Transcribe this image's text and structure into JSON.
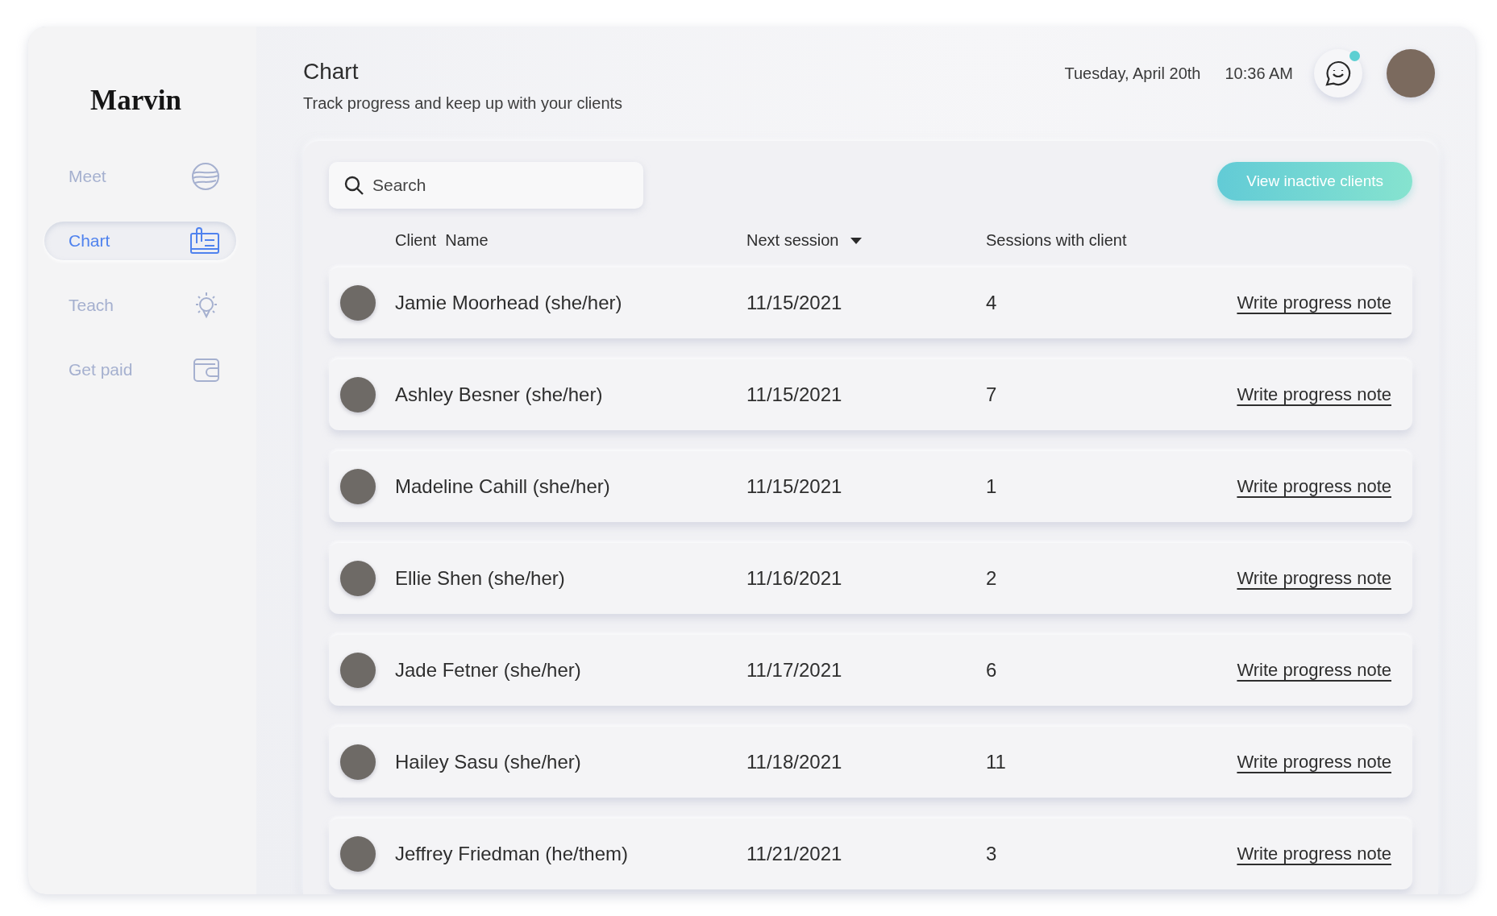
{
  "sidebar": {
    "logo": "Marvin",
    "items": [
      {
        "label": "Meet",
        "kind": "globe",
        "selected": false
      },
      {
        "label": "Chart",
        "kind": "clipboard",
        "selected": true
      },
      {
        "label": "Teach",
        "kind": "bulb",
        "selected": false
      },
      {
        "label": "Get paid",
        "kind": "wallet",
        "selected": false
      }
    ]
  },
  "header": {
    "title": "Chart",
    "subtitle": "Track progress and keep up with your clients",
    "date": "Tuesday, April 20th",
    "time": "10:36 AM",
    "chat_unread": true
  },
  "search": {
    "placeholder": "Search"
  },
  "inactive_button": "View inactive clients",
  "table": {
    "columns": [
      {
        "label": "Client  Name",
        "sorted": false
      },
      {
        "label": "Next session",
        "sorted": true
      },
      {
        "label": "Sessions with client",
        "sorted": false
      }
    ],
    "rows": [
      {
        "name": "Jamie Moorhead (she/her)",
        "next_session": "11/15/2021",
        "sessions": "4",
        "action": "Write progress note"
      },
      {
        "name": "Ashley Besner (she/her)",
        "next_session": "11/15/2021",
        "sessions": "7",
        "action": "Write progress note"
      },
      {
        "name": "Madeline Cahill (she/her)",
        "next_session": "11/15/2021",
        "sessions": "1",
        "action": "Write progress note"
      },
      {
        "name": "Ellie Shen (she/her)",
        "next_session": "11/16/2021",
        "sessions": "2",
        "action": "Write progress note"
      },
      {
        "name": "Jade Fetner (she/her)",
        "next_session": "11/17/2021",
        "sessions": "6",
        "action": "Write progress note"
      },
      {
        "name": "Hailey Sasu (she/her)",
        "next_session": "11/18/2021",
        "sessions": "11",
        "action": "Write progress note"
      },
      {
        "name": "Jeffrey Friedman (he/them)",
        "next_session": "11/21/2021",
        "sessions": "3",
        "action": "Write progress note"
      }
    ]
  }
}
